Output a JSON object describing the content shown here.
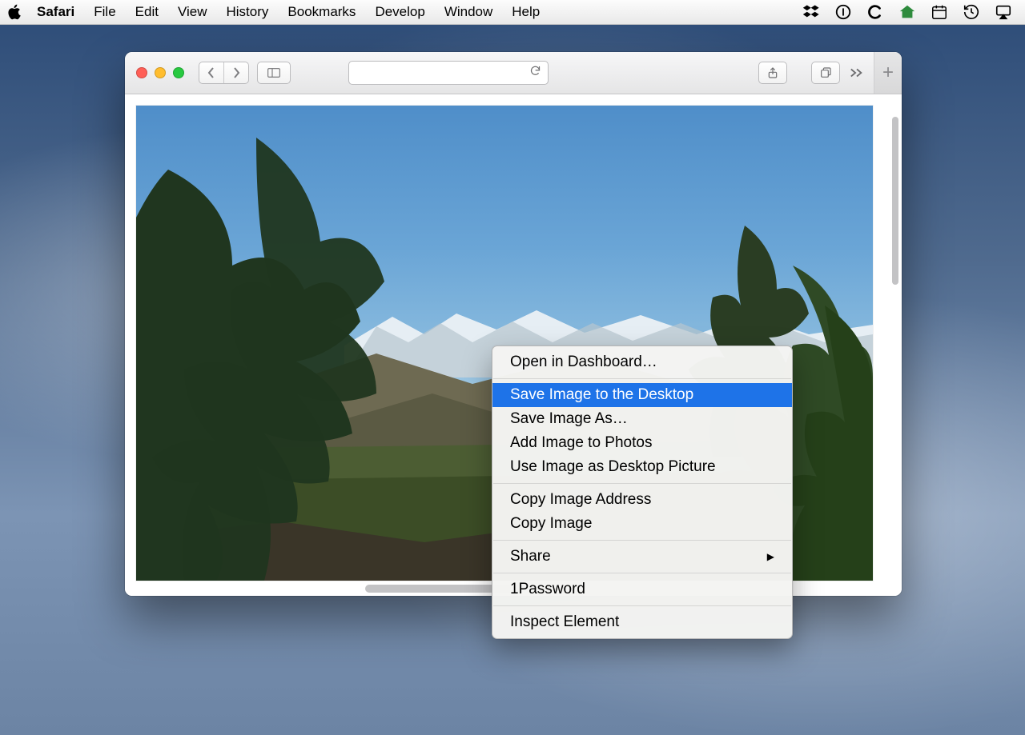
{
  "menubar": {
    "app": "Safari",
    "items": [
      "File",
      "Edit",
      "View",
      "History",
      "Bookmarks",
      "Develop",
      "Window",
      "Help"
    ]
  },
  "toolbar": {
    "url_value": "",
    "url_placeholder": ""
  },
  "context_menu": {
    "group1": [
      "Open in Dashboard…"
    ],
    "highlighted": "Save Image to the Desktop",
    "group2": [
      "Save Image As…",
      "Add Image to Photos",
      "Use Image as Desktop Picture"
    ],
    "group3": [
      "Copy Image Address",
      "Copy Image"
    ],
    "share": "Share",
    "group4": [
      "1Password"
    ],
    "group5": [
      "Inspect Element"
    ]
  },
  "newtab_label": "+"
}
